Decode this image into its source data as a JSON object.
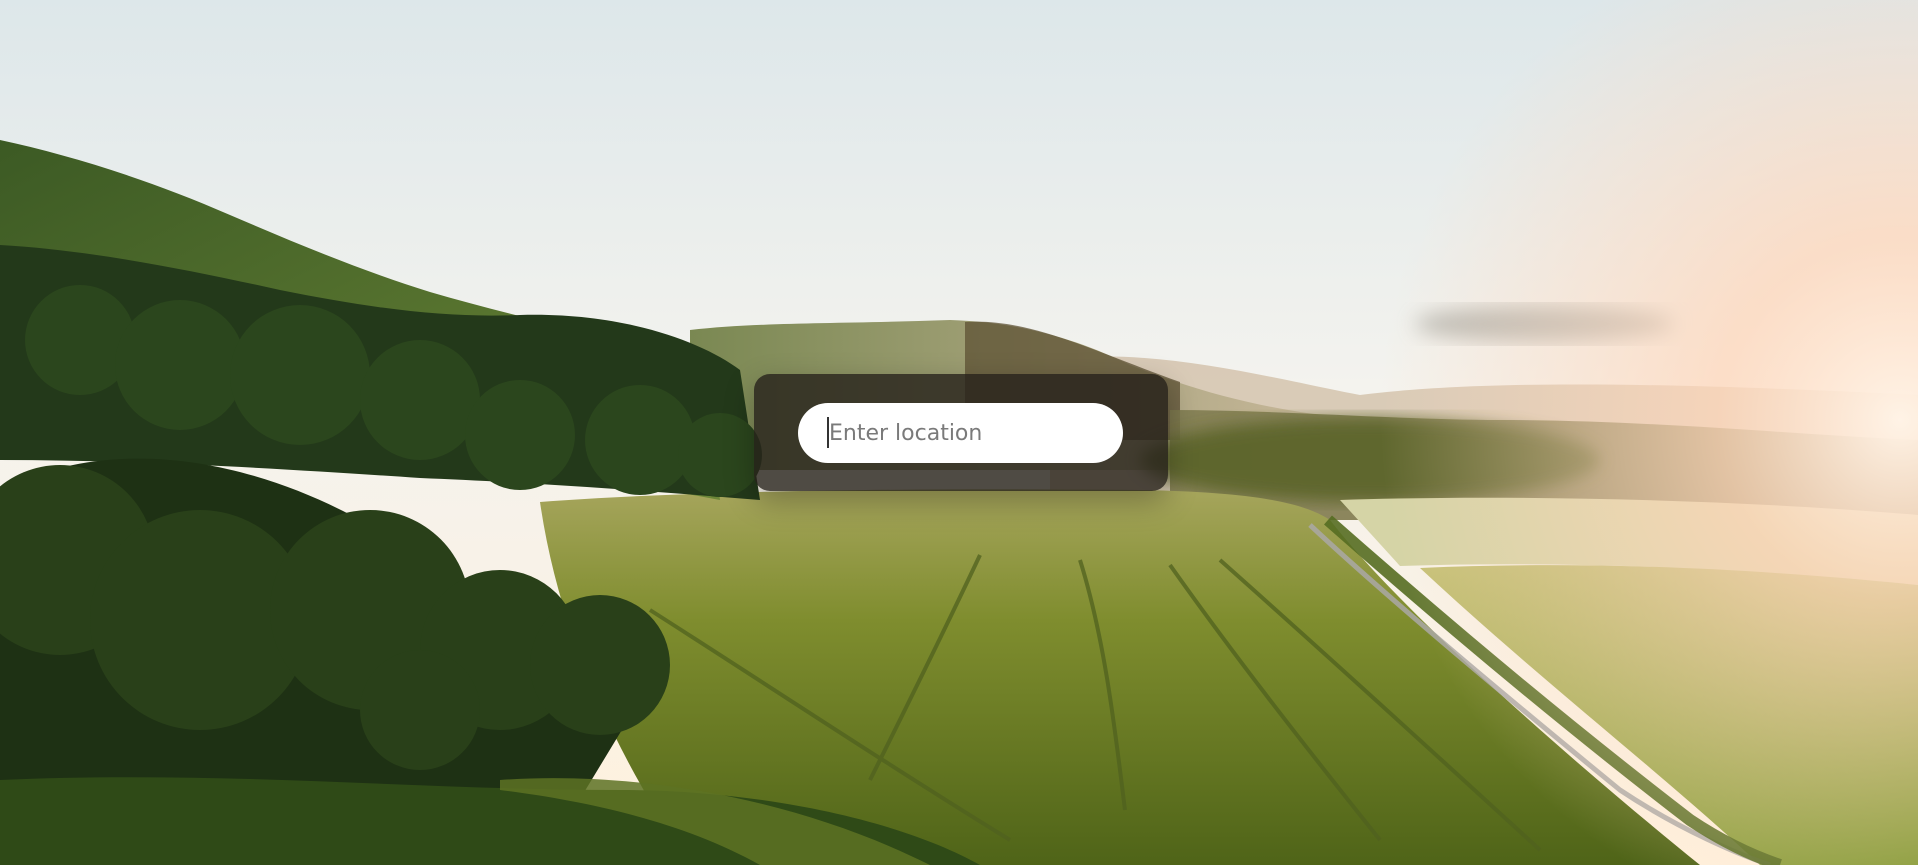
{
  "search": {
    "value": "",
    "placeholder": "Enter location"
  },
  "theme": {
    "sky_top": "#dde7ea",
    "sky_glow": "#fff4e0",
    "sun": "#ffd3b3",
    "field_green": "#7d8a2c",
    "tree_dark": "#233a17",
    "panel": "#26211a",
    "input_bg": "#ffffff"
  }
}
